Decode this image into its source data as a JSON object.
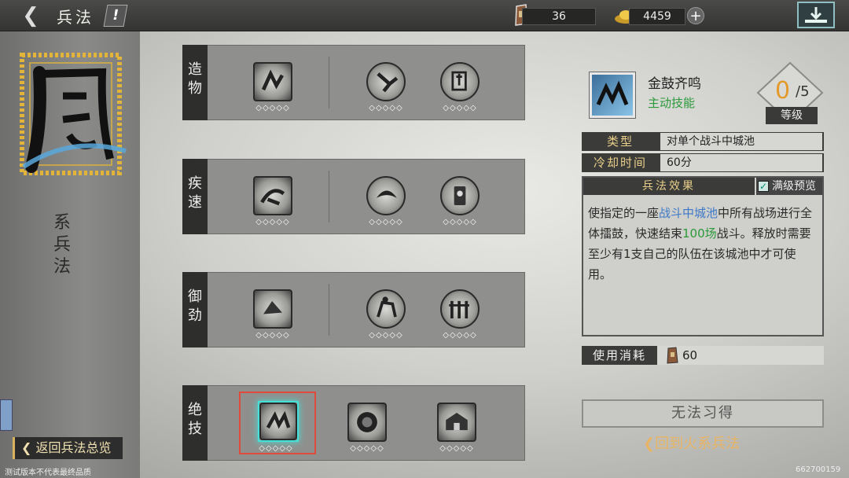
{
  "topbar": {
    "title": "兵法",
    "info_label": "!",
    "resource_1_value": "36",
    "resource_2_value": "4459",
    "plus_label": "+"
  },
  "left": {
    "emblem_char": "風",
    "school_label": "系兵法",
    "return_overview": "返回兵法总览",
    "disclaimer": "测试版本不代表最终品质",
    "build_id": "662700159"
  },
  "rows": [
    {
      "label": "造物",
      "skills": [
        "skill-1-1",
        "skill-1-2",
        "skill-1-3"
      ]
    },
    {
      "label": "疾速",
      "skills": [
        "skill-2-1",
        "skill-2-2",
        "skill-2-3"
      ]
    },
    {
      "label": "御劲",
      "skills": [
        "skill-3-1",
        "skill-3-2",
        "skill-3-3"
      ]
    },
    {
      "label": "绝技",
      "skills": [
        "skill-4-1",
        "skill-4-2",
        "skill-4-3"
      ]
    }
  ],
  "diamond_marks": "◇◇◇◇◇",
  "detail": {
    "name": "金鼓齐鸣",
    "kind": "主动技能",
    "level_current": "0",
    "level_max": "/5",
    "level_label": "等级",
    "type_key": "类型",
    "type_value": "对单个战斗中城池",
    "cooldown_key": "冷却时间",
    "cooldown_value": "60分",
    "effect_header": "兵法效果",
    "preview_label": "满级预览",
    "preview_checked": true,
    "effect_p1": "使指定的一座",
    "effect_hl1": "战斗中城池",
    "effect_p2": "中所有战场进行全体擂鼓，快速结束",
    "effect_hl2": "100场",
    "effect_p3": "战斗。释放时需要至少有1支自己的队伍在该城池中才可使用。",
    "cost_label": "使用消耗",
    "cost_value": "60",
    "learn_button": "无法习得",
    "return_fire": "回到火系兵法"
  },
  "colors": {
    "accent_gold": "#e9cf8a",
    "active_green": "#2a9a3a",
    "highlight_blue": "#3d79c8",
    "selection_red": "#e04a3a",
    "selection_cyan": "#46e0d8",
    "level_orange": "#e39a2a"
  }
}
